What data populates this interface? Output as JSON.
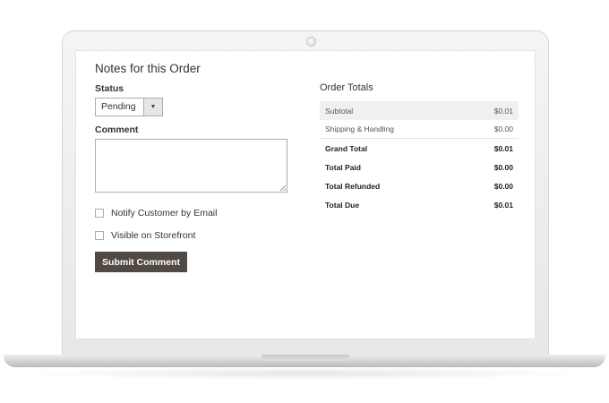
{
  "notes": {
    "title": "Notes for this Order",
    "status_label": "Status",
    "status_value": "Pending",
    "comment_label": "Comment",
    "comment_value": "",
    "checkboxes": [
      {
        "label": "Notify Customer by Email",
        "checked": false
      },
      {
        "label": "Visible on Storefront",
        "checked": false
      }
    ],
    "submit_label": "Submit Comment"
  },
  "totals": {
    "title": "Order Totals",
    "rows": [
      {
        "label": "Subtotal",
        "value": "$0.01"
      },
      {
        "label": "Shipping & Handling",
        "value": "$0.00"
      },
      {
        "label": "Grand Total",
        "value": "$0.01"
      },
      {
        "label": "Total Paid",
        "value": "$0.00"
      },
      {
        "label": "Total Refunded",
        "value": "$0.00"
      },
      {
        "label": "Total Due",
        "value": "$0.01"
      }
    ]
  },
  "colors": {
    "button_bg": "#514943",
    "button_text": "#ffffff",
    "shaded_row": "#f0f0f0"
  },
  "icons": {
    "select_arrow": "caret-down-icon"
  }
}
